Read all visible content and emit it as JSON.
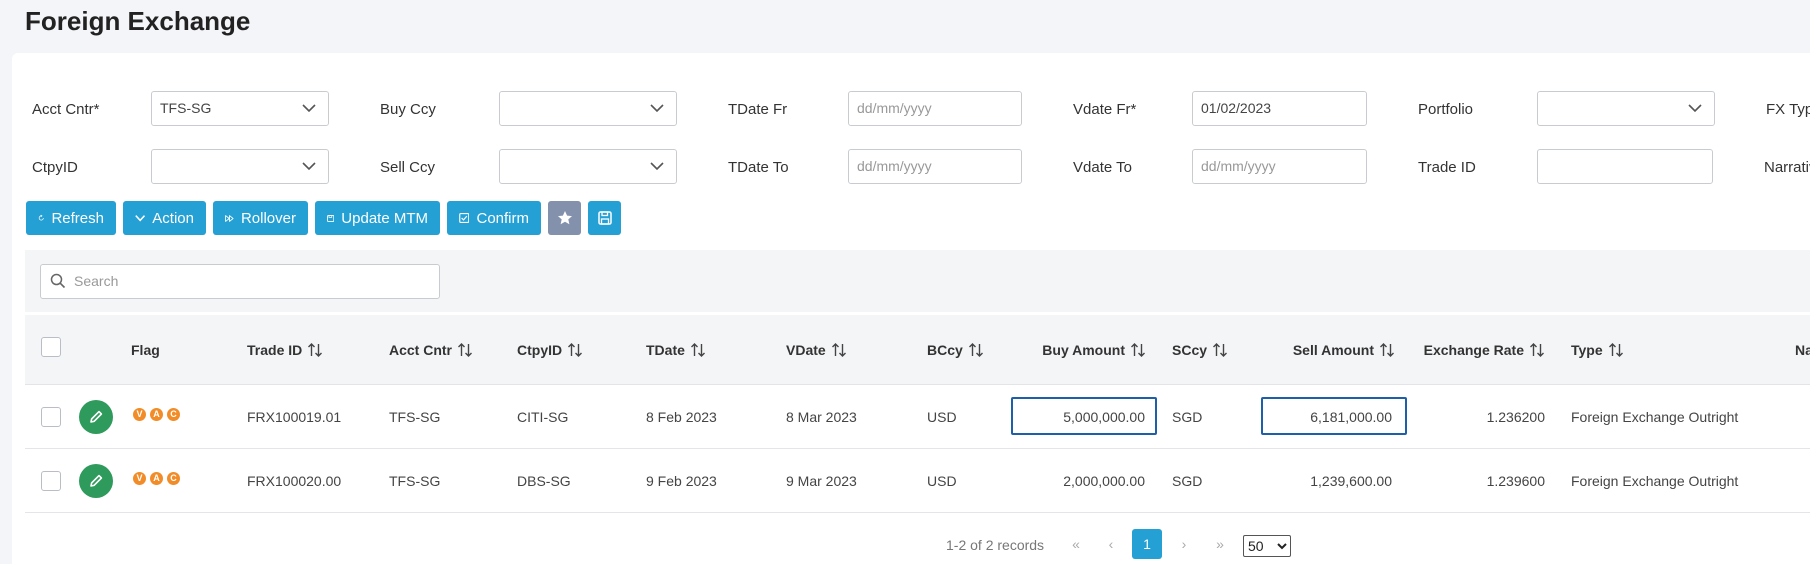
{
  "page": {
    "title": "Foreign Exchange"
  },
  "filters": {
    "acct_cntr": {
      "label": "Acct Cntr*",
      "value": "TFS-SG"
    },
    "buy_ccy": {
      "label": "Buy Ccy",
      "value": ""
    },
    "tdate_fr": {
      "label": "TDate Fr",
      "placeholder": "dd/mm/yyyy"
    },
    "vdate_fr": {
      "label": "Vdate Fr*",
      "value": "01/02/2023"
    },
    "portfolio": {
      "label": "Portfolio",
      "value": ""
    },
    "fx_type": {
      "label": "FX Type"
    },
    "ctpy_id": {
      "label": "CtpyID",
      "value": ""
    },
    "sell_ccy": {
      "label": "Sell Ccy",
      "value": ""
    },
    "tdate_to": {
      "label": "TDate To",
      "placeholder": "dd/mm/yyyy"
    },
    "vdate_to": {
      "label": "Vdate To",
      "placeholder": "dd/mm/yyyy"
    },
    "trade_id": {
      "label": "Trade ID",
      "value": ""
    },
    "narrative": {
      "label": "Narrative"
    }
  },
  "toolbar": {
    "refresh": "Refresh",
    "action": "Action",
    "rollover": "Rollover",
    "update_mtm": "Update MTM",
    "confirm": "Confirm"
  },
  "search": {
    "placeholder": "Search"
  },
  "table": {
    "headers": {
      "flag": "Flag",
      "trade_id": "Trade ID",
      "acct_cntr": "Acct Cntr",
      "ctpy_id": "CtpyID",
      "tdate": "TDate",
      "vdate": "VDate",
      "bccy": "BCcy",
      "buy_amount": "Buy Amount",
      "sccy": "SCcy",
      "sell_amount": "Sell Amount",
      "exchange_rate": "Exchange Rate",
      "type": "Type",
      "narrative": "Na"
    },
    "flag_letters": [
      "V",
      "A",
      "C"
    ],
    "rows": [
      {
        "trade_id": "FRX100019.01",
        "acct_cntr": "TFS-SG",
        "ctpy_id": "CITI-SG",
        "tdate": "8 Feb 2023",
        "vdate": "8 Mar 2023",
        "bccy": "USD",
        "buy_amount": "5,000,000.00",
        "sccy": "SGD",
        "sell_amount": "6,181,000.00",
        "exchange_rate": "1.236200",
        "type": "Foreign Exchange Outright"
      },
      {
        "trade_id": "FRX100020.00",
        "acct_cntr": "TFS-SG",
        "ctpy_id": "DBS-SG",
        "tdate": "9 Feb 2023",
        "vdate": "9 Mar 2023",
        "bccy": "USD",
        "buy_amount": "2,000,000.00",
        "sccy": "SGD",
        "sell_amount": "1,239,600.00",
        "exchange_rate": "1.239600",
        "type": "Foreign Exchange Outright"
      }
    ]
  },
  "pagination": {
    "summary": "1-2 of 2 records",
    "current_page": "1",
    "page_size": "50"
  },
  "colors": {
    "primary": "#25a0d4",
    "edit": "#2e9a5b",
    "flag": "#f28c28",
    "selected_cell": "#1f5fa8",
    "favorite": "#8391ad"
  }
}
